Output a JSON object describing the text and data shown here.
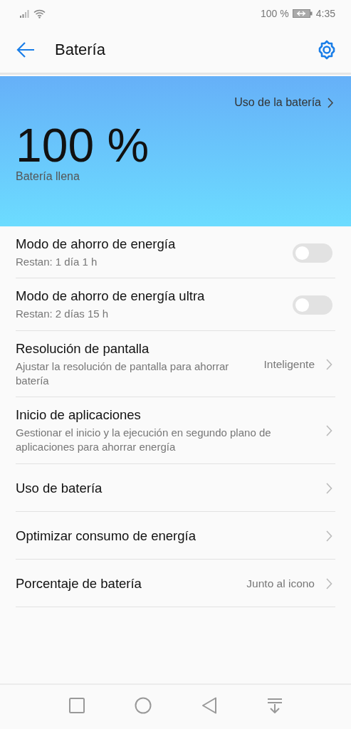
{
  "status_bar": {
    "battery_percent": "100 %",
    "time": "4:35"
  },
  "header": {
    "title": "Batería"
  },
  "hero": {
    "link": "Uso de la batería",
    "percent": "100 %",
    "status": "Batería llena"
  },
  "settings": [
    {
      "kind": "toggle",
      "title": "Modo de ahorro de energía",
      "subtitle": "Restan: 1 día 1 h",
      "on": false
    },
    {
      "kind": "toggle",
      "title": "Modo de ahorro de energía ultra",
      "subtitle": "Restan: 2 días 15 h",
      "on": false
    },
    {
      "kind": "link",
      "title": "Resolución de pantalla",
      "subtitle": "Ajustar la resolución de pantalla para ahorrar batería",
      "value": "Inteligente"
    },
    {
      "kind": "link",
      "title": "Inicio de aplicaciones",
      "subtitle": "Gestionar el inicio y la ejecución en segundo plano de aplicaciones para ahorrar energía"
    },
    {
      "kind": "link",
      "title": "Uso de batería"
    },
    {
      "kind": "link",
      "title": "Optimizar consumo de energía"
    },
    {
      "kind": "link",
      "title": "Porcentaje de batería",
      "value": "Junto al icono"
    }
  ]
}
